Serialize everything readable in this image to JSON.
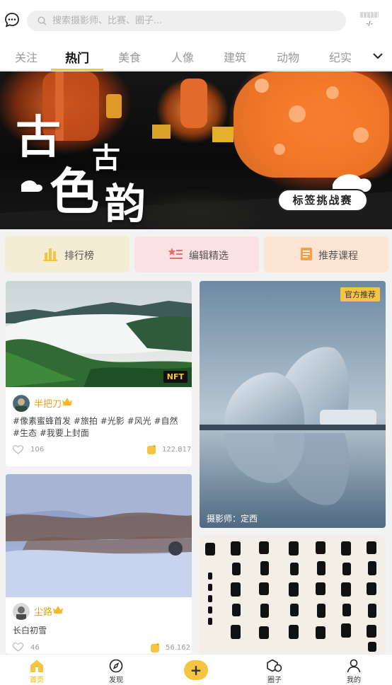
{
  "search": {
    "placeholder": "搜索摄影师、比赛、圈子..."
  },
  "status": {
    "text": "-/-"
  },
  "tabs": [
    {
      "label": "关注",
      "active": false
    },
    {
      "label": "热门",
      "active": true
    },
    {
      "label": "美食",
      "active": false
    },
    {
      "label": "人像",
      "active": false
    },
    {
      "label": "建筑",
      "active": false
    },
    {
      "label": "动物",
      "active": false
    },
    {
      "label": "纪实",
      "active": false
    }
  ],
  "banner": {
    "title_chars": [
      "古",
      "古",
      "色",
      "韵"
    ],
    "badge": "标签挑战赛"
  },
  "actions": [
    {
      "label": "排行榜",
      "icon": "bar-chart-icon",
      "color": "#f5c542"
    },
    {
      "label": "编辑精选",
      "icon": "star-list-icon",
      "color": "#ee6b6b"
    },
    {
      "label": "推荐课程",
      "icon": "book-icon",
      "color": "#f5a04a"
    }
  ],
  "cards": {
    "c1": {
      "badge": "NFT",
      "author": "半把刀",
      "desc": "#像素蜜蜂首发 #旅拍 #光影 #风光 #自然 #生态 #我要上封面",
      "likes": "106",
      "coins": "122.817"
    },
    "c2": {
      "badge": "官方推荐",
      "credit": "摄影师：定西"
    },
    "c3": {
      "author": "尘路",
      "desc": "长白初雪",
      "likes": "46",
      "coins": "56.162"
    }
  },
  "nav": {
    "home": "首页",
    "discover": "发现",
    "post": "+",
    "circle": "圈子",
    "me": "我的"
  },
  "colors": {
    "accent": "#f5c542",
    "author": "#e4a21a"
  }
}
